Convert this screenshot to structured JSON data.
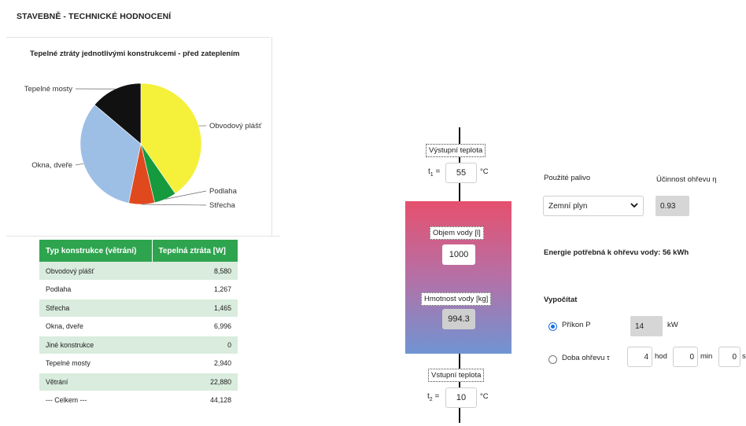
{
  "section_title": "STAVEBNĚ - TECHNICKÉ HODNOCENÍ",
  "chart_data": {
    "type": "pie",
    "title": "Tepelné ztráty jednotlivými konstrukcemi - před zateplením",
    "slices": [
      {
        "label": "Obvodový plášť",
        "value": 8580,
        "color": "#f5f03a"
      },
      {
        "label": "Podlaha",
        "value": 1267,
        "color": "#159a3e"
      },
      {
        "label": "Střecha",
        "value": 1465,
        "color": "#e0481e"
      },
      {
        "label": "Okna, dveře",
        "value": 6996,
        "color": "#9dbfe6"
      },
      {
        "label": "Tepelné mosty",
        "value": 2940,
        "color": "#111111"
      }
    ]
  },
  "table": {
    "headers": [
      "Typ konstrukce (větrání)",
      "Tepelná ztráta [W]"
    ],
    "rows": [
      {
        "name": "Obvodový plášť",
        "value": "8,580"
      },
      {
        "name": "Podlaha",
        "value": "1,267"
      },
      {
        "name": "Střecha",
        "value": "1,465"
      },
      {
        "name": "Okna, dveře",
        "value": "6,996"
      },
      {
        "name": "Jiné konstrukce",
        "value": "0"
      },
      {
        "name": "Tepelné mosty",
        "value": "2,940"
      },
      {
        "name": "Větrání",
        "value": "22,880"
      },
      {
        "name": "--- Celkem ---",
        "value": "44,128"
      }
    ]
  },
  "heater": {
    "outlet_label": "Výstupní teplota",
    "t1_prefix": "t",
    "t1_sub": "1",
    "t1_value": "55",
    "t1_unit": "°C",
    "volume_label": "Objem vody [l]",
    "volume_value": "1000",
    "mass_label": "Hmotnost vody [kg]",
    "mass_value": "994.3",
    "inlet_label": "Vstupní teplota",
    "t2_prefix": "t",
    "t2_sub": "2",
    "t2_value": "10",
    "t2_unit": "°C"
  },
  "controls": {
    "fuel_label": "Použité palivo",
    "efficiency_label": "Účinnost ohřevu η",
    "fuel_selected": "Zemní plyn",
    "efficiency_value": "0.93",
    "energy_text": "Energie potřebná k ohřevu vody: 56 kWh",
    "compute_label": "Vypočítat",
    "power_label": "Příkon P",
    "power_value": "14",
    "power_unit": "kW",
    "duration_label": "Doba ohřevu τ",
    "hours_value": "4",
    "hours_unit": "hod",
    "minutes_value": "0",
    "minutes_unit": "min",
    "seconds_value": "0",
    "seconds_unit": "s"
  },
  "colors": {
    "table_header": "#2ea44f",
    "table_row_alt": "#d9ecdd",
    "radio_accent": "#1a6fe0"
  }
}
